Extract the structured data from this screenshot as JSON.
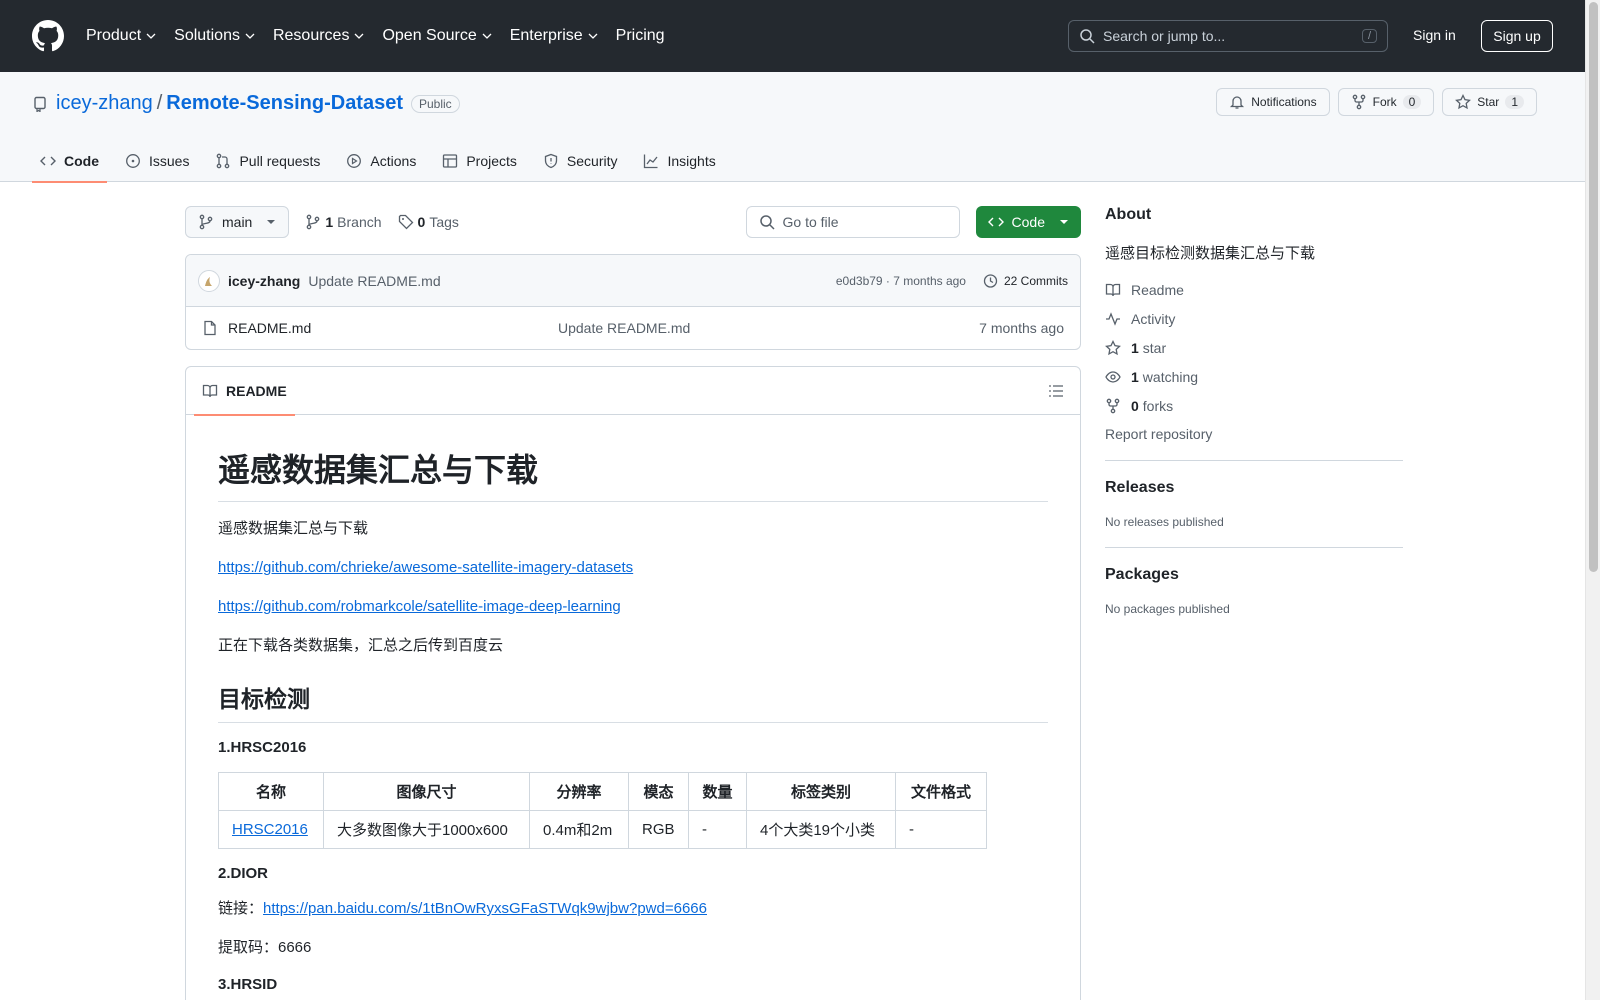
{
  "nav": {
    "items": [
      {
        "label": "Product",
        "has_menu": true
      },
      {
        "label": "Solutions",
        "has_menu": true
      },
      {
        "label": "Resources",
        "has_menu": true
      },
      {
        "label": "Open Source",
        "has_menu": true
      },
      {
        "label": "Enterprise",
        "has_menu": true
      },
      {
        "label": "Pricing",
        "has_menu": false
      }
    ],
    "search_placeholder": "Search or jump to...",
    "search_shortcut": "/",
    "signin": "Sign in",
    "signup": "Sign up"
  },
  "repo": {
    "owner": "icey-zhang",
    "separator": "/",
    "name": "Remote-Sensing-Dataset",
    "visibility": "Public",
    "notifications_label": "Notifications",
    "fork_label": "Fork",
    "fork_count": "0",
    "star_label": "Star",
    "star_count": "1"
  },
  "tabs": [
    {
      "label": "Code",
      "icon": "code-icon",
      "active": true
    },
    {
      "label": "Issues",
      "icon": "issue-icon"
    },
    {
      "label": "Pull requests",
      "icon": "pull-request-icon"
    },
    {
      "label": "Actions",
      "icon": "play-icon"
    },
    {
      "label": "Projects",
      "icon": "table-icon"
    },
    {
      "label": "Security",
      "icon": "shield-icon"
    },
    {
      "label": "Insights",
      "icon": "graph-icon"
    }
  ],
  "toolbar": {
    "branch": "main",
    "branch_count": "1",
    "branch_label": "Branch",
    "tag_count": "0",
    "tag_label": "Tags",
    "goto_file": "Go to file",
    "code_button": "Code"
  },
  "commit": {
    "author": "icey-zhang",
    "message": "Update README.md",
    "meta": "e0d3b79 · 7 months ago",
    "commits": "22 Commits"
  },
  "files": [
    {
      "name": "README.md",
      "message": "Update README.md",
      "time": "7 months ago"
    }
  ],
  "readme": {
    "tab": "README",
    "title": "遥感数据集汇总与下载",
    "intro": "遥感数据集汇总与下载",
    "link1": "https://github.com/chrieke/awesome-satellite-imagery-datasets",
    "link2": "https://github.com/robmarkcole/satellite-image-deep-learning",
    "note": "正在下载各类数据集，汇总之后传到百度云",
    "section": "目标检测",
    "item1": "1.HRSC2016",
    "table": {
      "headers": [
        "名称",
        "图像尺寸",
        "分辨率",
        "模态",
        "数量",
        "标签类别",
        "文件格式"
      ],
      "row": [
        "HRSC2016",
        "大多数图像大于1000x600",
        "0.4m和2m",
        "RGB",
        "-",
        "4个大类19个小类",
        "-"
      ]
    },
    "item2": "2.DIOR",
    "link_label": "链接：",
    "baidu_link": "https://pan.baidu.com/s/1tBnOwRyxsGFaSTWqk9wjbw?pwd=6666",
    "code_line": "提取码：6666",
    "item3": "3.HRSID"
  },
  "sidebar": {
    "about_title": "About",
    "description": "遥感目标检测数据集汇总与下载",
    "readme": "Readme",
    "activity": "Activity",
    "stars_count": "1",
    "stars_label": "star",
    "watching_count": "1",
    "watching_label": "watching",
    "forks_count": "0",
    "forks_label": "forks",
    "report": "Report repository",
    "releases_title": "Releases",
    "releases_empty": "No releases published",
    "packages_title": "Packages",
    "packages_empty": "No packages published"
  },
  "colors": {
    "header_bg": "#24292f",
    "link": "#0969da",
    "accent_tab": "#fd8c73",
    "code_button": "#1f883d"
  }
}
